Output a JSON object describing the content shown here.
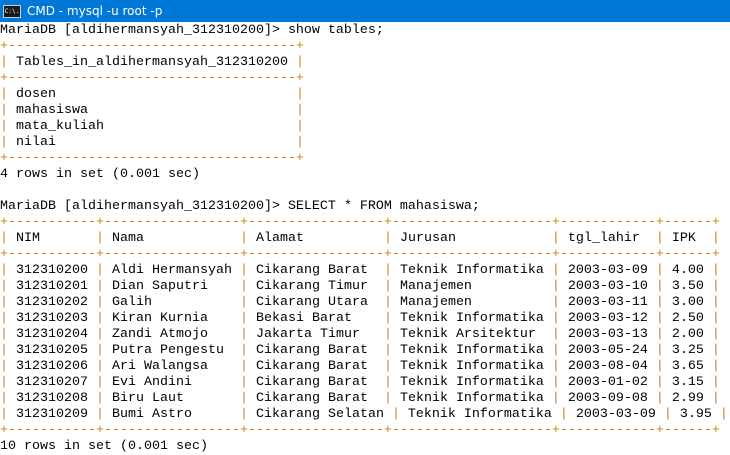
{
  "window": {
    "title": "CMD - mysql  -u root -p",
    "icon": "cmd-icon",
    "icon_text": "C:\\."
  },
  "colors": {
    "titlebar": "#0078d7",
    "border": "#c8821e",
    "text": "#000000"
  },
  "session": [
    {
      "prompt": "MariaDB [aldihermansyah_312310200]> ",
      "command": "show tables;",
      "headers": [
        "Tables_in_aldihermansyah_312310200"
      ],
      "widths": [
        34
      ],
      "align": [
        "l"
      ],
      "rows": [
        [
          "dosen"
        ],
        [
          "mahasiswa"
        ],
        [
          "mata_kuliah"
        ],
        [
          "nilai"
        ]
      ],
      "result": "4 rows in set (0.001 sec)"
    },
    {
      "prompt": "MariaDB [aldihermansyah_312310200]> ",
      "command": "SELECT * FROM mahasiswa;",
      "headers": [
        "NIM",
        "Nama",
        "Alamat",
        "Jurusan",
        "tgl_lahir",
        "IPK"
      ],
      "widths": [
        9,
        15,
        15,
        18,
        10,
        4
      ],
      "align": [
        "l",
        "l",
        "l",
        "l",
        "l",
        "l"
      ],
      "rows": [
        [
          "312310200",
          "Aldi Hermansyah",
          "Cikarang Barat",
          "Teknik Informatika",
          "2003-03-09",
          "4.00"
        ],
        [
          "312310201",
          "Dian Saputri",
          "Cikarang Timur",
          "Manajemen",
          "2003-03-10",
          "3.50"
        ],
        [
          "312310202",
          "Galih",
          "Cikarang Utara",
          "Manajemen",
          "2003-03-11",
          "3.00"
        ],
        [
          "312310203",
          "Kiran Kurnia",
          "Bekasi Barat",
          "Teknik Informatika",
          "2003-03-12",
          "2.50"
        ],
        [
          "312310204",
          "Zandi Atmojo",
          "Jakarta Timur",
          "Teknik Arsitektur",
          "2003-03-13",
          "2.00"
        ],
        [
          "312310205",
          "Putra Pengestu",
          "Cikarang Barat",
          "Teknik Informatika",
          "2003-05-24",
          "3.25"
        ],
        [
          "312310206",
          "Ari Walangsa",
          "Cikarang Barat",
          "Teknik Informatika",
          "2003-08-04",
          "3.65"
        ],
        [
          "312310207",
          "Evi Andini",
          "Cikarang Barat",
          "Teknik Informatika",
          "2003-01-02",
          "3.15"
        ],
        [
          "312310208",
          "Biru Laut",
          "Cikarang Barat",
          "Teknik Informatika",
          "2003-09-08",
          "2.99"
        ],
        [
          "312310209",
          "Bumi Astro",
          "Cikarang Selatan",
          "Teknik Informatika",
          "2003-03-09",
          "3.95"
        ]
      ],
      "result": "10 rows in set (0.001 sec)"
    }
  ]
}
